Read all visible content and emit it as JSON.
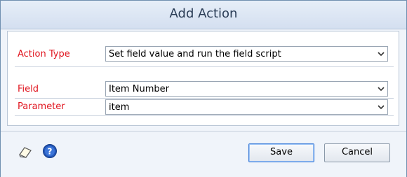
{
  "dialog": {
    "title": "Add Action"
  },
  "form": {
    "action_type": {
      "label": "Action Type",
      "value": "Set field value and run the field script"
    },
    "field": {
      "label": "Field",
      "value": "Item Number"
    },
    "parameter": {
      "label": "Parameter",
      "value": "item"
    }
  },
  "footer": {
    "save_label": "Save",
    "cancel_label": "Cancel",
    "icons": [
      "note-icon",
      "help-icon"
    ]
  },
  "colors": {
    "label_red": "#e0141e",
    "title_text": "#2a3c55",
    "help_blue": "#2457b8"
  }
}
